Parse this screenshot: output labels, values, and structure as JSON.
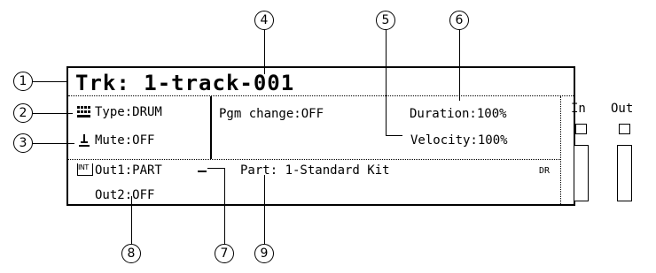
{
  "track": {
    "title": "Trk:  1-track-001"
  },
  "params": {
    "type": "Type:DRUM",
    "mute": "Mute:OFF",
    "pgm_change": "Pgm change:OFF",
    "duration": "Duration:100%",
    "velocity": "Velocity:100%",
    "out1": "Out1:PART",
    "out2": "Out2:OFF",
    "part": "Part:  1-Standard Kit",
    "part_badge": "DR"
  },
  "meters": {
    "in_label": "In",
    "out_label": "Out"
  },
  "icons": {
    "int_badge": "INT",
    "type_icon": "drum-grid-icon",
    "mute_icon": "mute-icon"
  },
  "callouts": [
    "1",
    "2",
    "3",
    "4",
    "5",
    "6",
    "7",
    "8",
    "9"
  ]
}
